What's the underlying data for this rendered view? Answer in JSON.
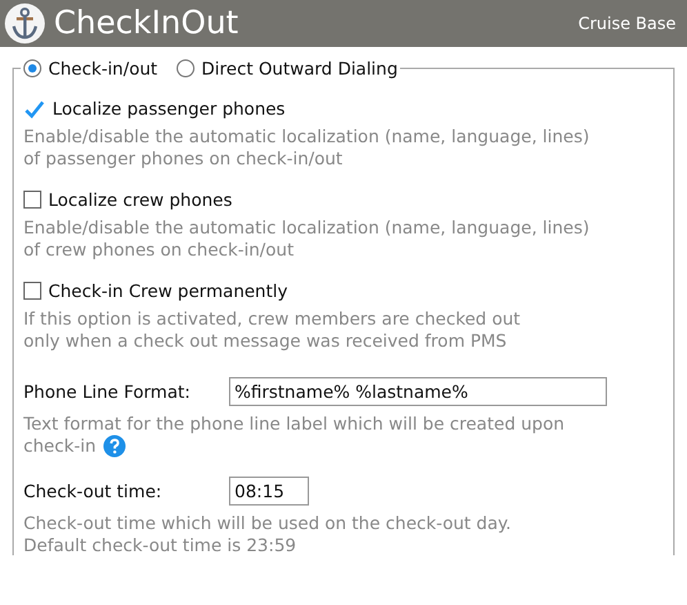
{
  "header": {
    "title": "CheckInOut",
    "subtitle": "Cruise Base"
  },
  "modes": [
    {
      "label": "Check-in/out",
      "selected": true
    },
    {
      "label": "Direct Outward Dialing",
      "selected": false
    }
  ],
  "options": [
    {
      "kind": "checkbox",
      "label": "Localize passenger phones",
      "checked": true,
      "description": [
        "Enable/disable the automatic localization (name, language, lines)",
        "of passenger phones on check-in/out"
      ]
    },
    {
      "kind": "checkbox",
      "label": "Localize crew phones",
      "checked": false,
      "description": [
        "Enable/disable the automatic localization (name, language, lines)",
        "of crew phones on check-in/out"
      ]
    },
    {
      "kind": "checkbox",
      "label": "Check-in Crew permanently",
      "checked": false,
      "description": [
        "If this option is activated, crew members are checked out",
        "only when a check out message was received from PMS"
      ]
    },
    {
      "kind": "text",
      "label": "Phone Line Format:",
      "value": "%firstname% %lastname%",
      "description": [
        "Text format for the phone line label which will be created upon",
        "check-in"
      ],
      "help": true
    },
    {
      "kind": "time",
      "label": "Check-out time:",
      "value": "08:15",
      "description": [
        "Check-out time which will be used on the check-out day.",
        "Default check-out time is 23:59"
      ],
      "help": false
    }
  ]
}
